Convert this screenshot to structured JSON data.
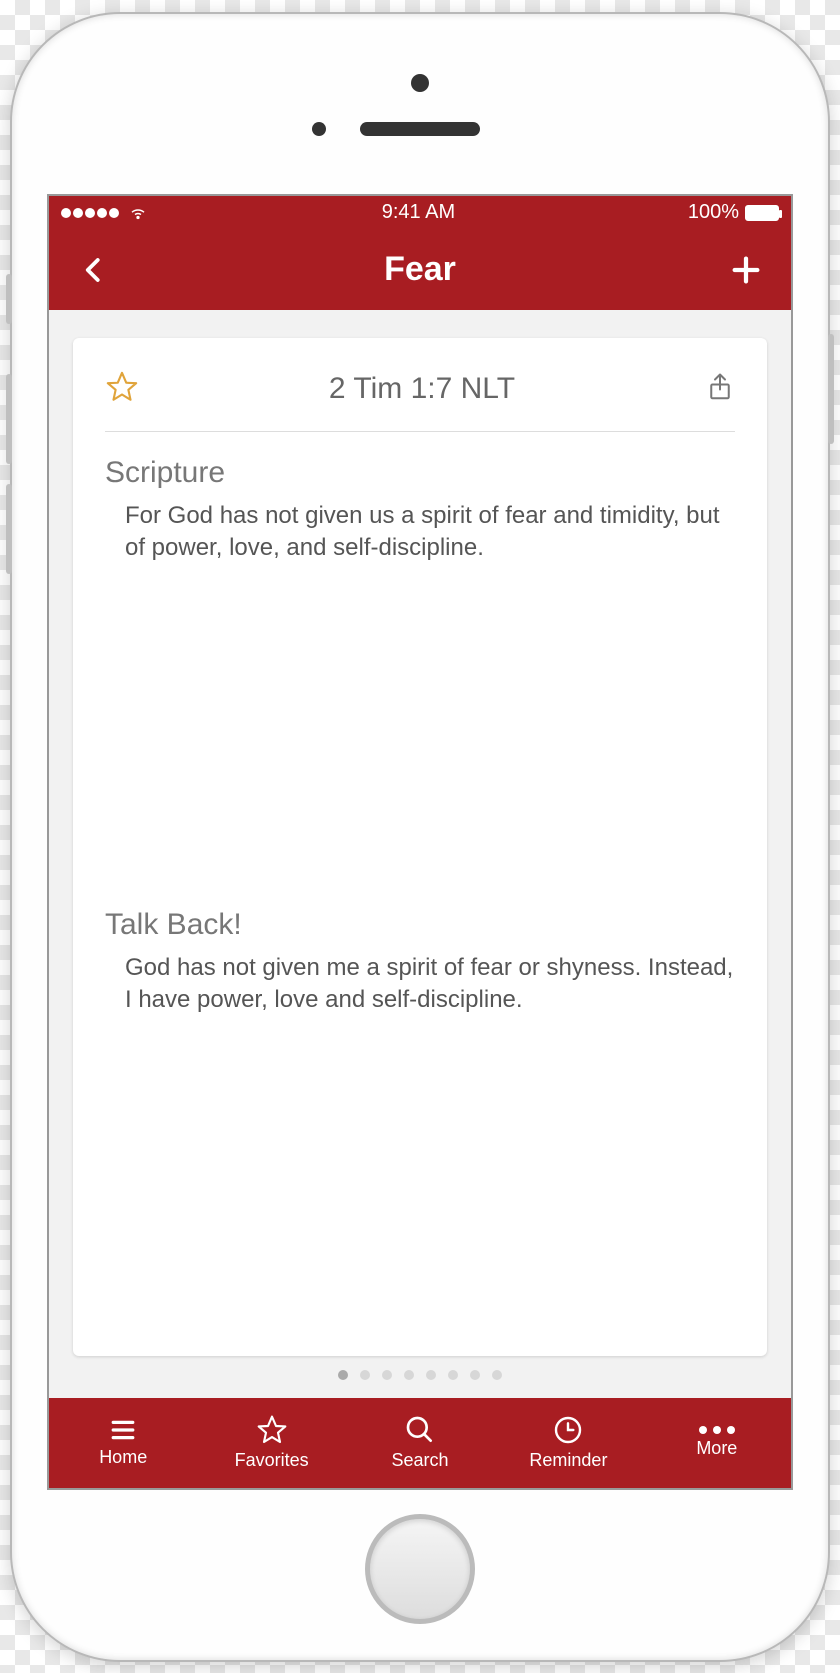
{
  "status": {
    "time": "9:41 AM",
    "battery": "100%"
  },
  "nav": {
    "title": "Fear"
  },
  "card": {
    "reference": "2 Tim 1:7 NLT",
    "scripture_heading": "Scripture",
    "scripture_text": "For God has not given us a spirit of fear and timidity, but of power, love, and self-discipline.",
    "talkback_heading": "Talk Back!",
    "talkback_text": "God has not given me a spirit of fear or shyness. Instead, I have power, love and self-discipline."
  },
  "pager": {
    "count": 8,
    "active": 0
  },
  "tabs": {
    "home": "Home",
    "favorites": "Favorites",
    "search": "Search",
    "reminder": "Reminder",
    "more": "More"
  }
}
